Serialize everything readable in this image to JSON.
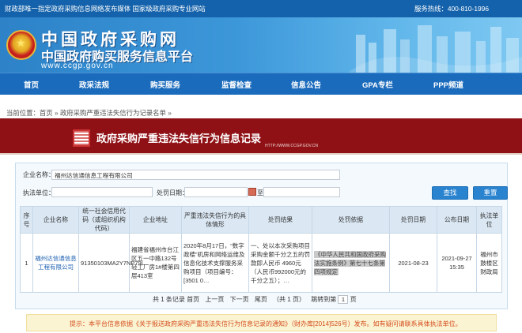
{
  "topbar": {
    "left": "财政部唯一指定政府采购信息网络发布媒体 国家级政府采购专业网站",
    "right": "服务热线：400-810-1996"
  },
  "banner": {
    "title": "中国政府采购网",
    "subtitle": "中国政府购买服务信息平台",
    "url": "www.ccgp.gov.cn"
  },
  "nav": [
    "首页",
    "政采法规",
    "购买服务",
    "监督检查",
    "信息公告",
    "GPA专栏",
    "PPP频道"
  ],
  "breadcrumb": {
    "prefix": "当前位置：",
    "home": "首页",
    "sep1": " » ",
    "page": "政府采购严重违法失信行为记录名单",
    "sep2": " »"
  },
  "title_bar": {
    "title": "政府采购严重违法失信行为信息记录",
    "url": "HTTP://WWW.CCGP.GOV.CN"
  },
  "search": {
    "company_label": "企业名称：",
    "company_value": "福州达信通信息工程有限公司",
    "exec_label": "执法单位：",
    "exec_value": "",
    "date_label": "处罚日期：",
    "date_from": "",
    "to_label": "至",
    "date_to": "",
    "search_btn": "查找",
    "reset_btn": "重置"
  },
  "table": {
    "headers": [
      "序号",
      "企业名称",
      "统一社会信用代码（或组织机构代码）",
      "企业地址",
      "严重违法失信行为的具体情形",
      "处罚结果",
      "处罚依据",
      "处罚日期",
      "公布日期",
      "执法单位"
    ],
    "rows": [
      {
        "no": "1",
        "name": "福州达信通信息工程有限公司",
        "code": "91350103MA2Y7NP79L",
        "address": "福建省福州市台江区五一中路132号轻工厂房1#楼第四层413室",
        "situation": "2020年8月17日，“数字政楼”机房和网络运维及信息化技术支撑服务采购项目（项目编号：[3501 0…",
        "result": "一、处以本次采购项目采购金额千分之五的罚款即人民币 4960元（人民币992000元的千分之五）；…",
        "basis": "《中华人民共和国政府采购法实施条例》第七十七条第四项规定",
        "penalty_date": "2021-08-23",
        "publish_date": "2021-09-27 15:35",
        "authority": "福州市鼓楼区财政局"
      }
    ]
  },
  "pager": {
    "summary": "共 1 条记录 首页",
    "prev": "上一页",
    "next": "下一页",
    "last": "尾页",
    "page_info": "（共 1 页）",
    "jump_label": "跳转到第",
    "page_value": "1",
    "page_suffix": "页"
  },
  "notice": {
    "text": "提示：本平台信息依据《关于报送政府采购严重违法失信行为信息记录的通知》（财办库[2014]526号）发布。如有疑问请联系具体执法单位。"
  },
  "colors": {
    "topbar": "#1462ab",
    "nav": "#1a6bbc",
    "title_bar": "#8f1115",
    "link": "#1b5fb1",
    "notice_text": "#d44c1e"
  }
}
